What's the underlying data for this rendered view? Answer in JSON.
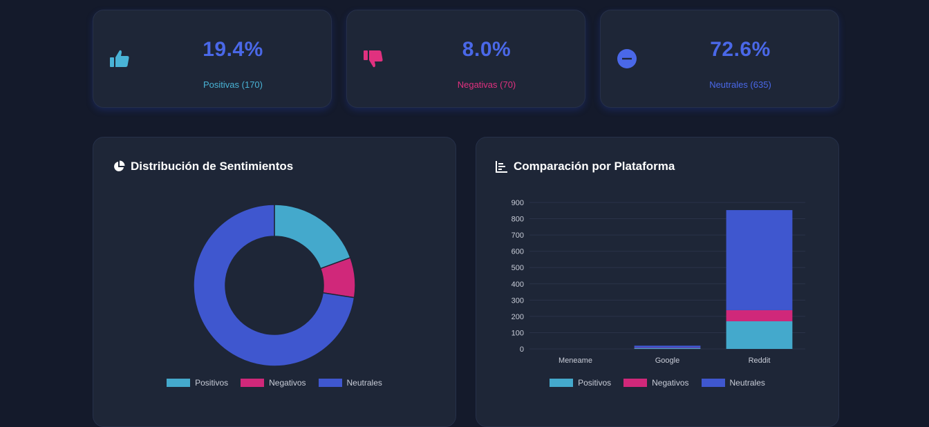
{
  "stats": [
    {
      "value": "19.4%",
      "label": "Positivas (170)",
      "color": "#49b3d6",
      "icon": "thumbs-up-icon"
    },
    {
      "value": "8.0%",
      "label": "Negativas (70)",
      "color": "#e0317f",
      "icon": "thumbs-down-icon"
    },
    {
      "value": "72.6%",
      "label": "Neutrales (635)",
      "color": "#4a68e8",
      "icon": "minus-circle-icon"
    }
  ],
  "colors": {
    "positivos": "#44a9cc",
    "negativos": "#d0287a",
    "neutrales": "#3f57cf"
  },
  "chart_data": [
    {
      "type": "pie",
      "title": "Distribución de Sentimientos",
      "labels": [
        "Positivos",
        "Negativos",
        "Neutrales"
      ],
      "values": [
        170,
        70,
        635
      ],
      "legend": "bottom"
    },
    {
      "type": "bar",
      "stacked": true,
      "title": "Comparación por Plataforma",
      "categories": [
        "Meneame",
        "Google",
        "Reddit"
      ],
      "series": [
        {
          "name": "Positivos",
          "values": [
            0,
            5,
            170
          ]
        },
        {
          "name": "Negativos",
          "values": [
            0,
            2,
            68
          ]
        },
        {
          "name": "Neutrales",
          "values": [
            0,
            13,
            615
          ]
        }
      ],
      "ylim": [
        0,
        900
      ],
      "yticks": [
        0,
        100,
        200,
        300,
        400,
        500,
        600,
        700,
        800,
        900
      ],
      "grid": true,
      "legend": "bottom"
    }
  ]
}
